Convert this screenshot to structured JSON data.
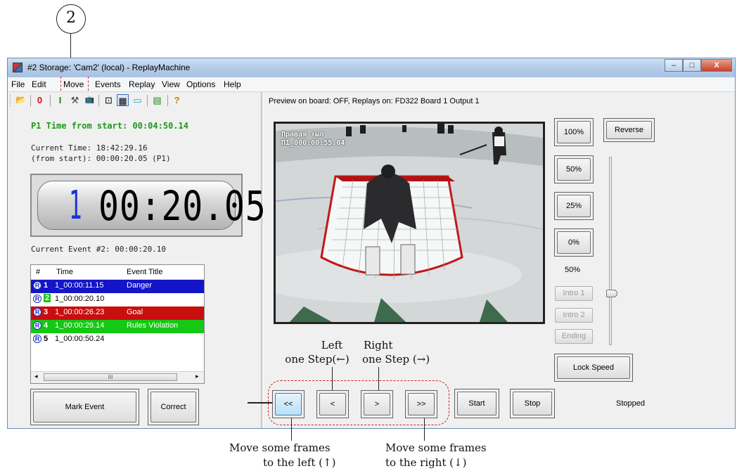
{
  "callout": {
    "number": "2"
  },
  "window": {
    "title": "#2 Storage: 'Cam2' (local) - ReplayMachine",
    "buttons": {
      "minimize": "–",
      "maximize": "□",
      "close": "X"
    }
  },
  "menu": [
    "File",
    "Edit",
    "Move",
    "Events",
    "Replay",
    "View",
    "Options",
    "Help"
  ],
  "toolbar": {
    "icons": [
      "open-folder",
      "zero",
      "info",
      "tools",
      "tv",
      "camera",
      "clapper",
      "monitor",
      "list",
      "help"
    ],
    "glyphs": [
      "📂",
      "0",
      "I",
      "⚒",
      "📺",
      "⊡",
      "▦",
      "▭",
      "▤",
      "?"
    ]
  },
  "preview_bar": "Preview on board: OFF, Replays on: FD322 Board 1 Output 1",
  "left": {
    "p1_time": "P1 Time from start: 00:04:50.14",
    "current_time": "Current Time: 18:42:29.16",
    "from_start": "(from start): 00:00:20.05 (P1)",
    "timer_index": "1",
    "timer_value": "00:20.05",
    "current_event": "Current Event #2: 00:00:20.10"
  },
  "events": {
    "headers": [
      "#",
      "Time",
      "Event Title"
    ],
    "rows": [
      {
        "num": "1",
        "time": "1_00:00:11.15",
        "title": "Danger",
        "bg": "#1414c8",
        "fg": "#ffffff"
      },
      {
        "num": "2",
        "time": "1_00:00:20.10",
        "title": "",
        "bg": "#ffffff",
        "fg": "#000000"
      },
      {
        "num": "3",
        "time": "1_00:00:26.23",
        "title": "Goal",
        "bg": "#c80e0e",
        "fg": "#ffffff"
      },
      {
        "num": "4",
        "time": "1_00:00:29.14",
        "title": "Rules Violation",
        "bg": "#14c814",
        "fg": "#ffffff"
      },
      {
        "num": "5",
        "time": "1_00:00:50.24",
        "title": "",
        "bg": "#ffffff",
        "fg": "#000000"
      }
    ],
    "scroll_glyph": "III"
  },
  "buttons": {
    "mark_event": "Mark Event",
    "correct": "Correct",
    "speed_100": "100%",
    "reverse": "Reverse",
    "speed_50": "50%",
    "speed_25": "25%",
    "speed_0": "0%",
    "speed_label": "50%",
    "intro1": "Intro 1",
    "intro2": "Intro 2",
    "ending": "Ending",
    "lock_speed": "Lock Speed",
    "step_far_left": "<<",
    "step_left": "<",
    "step_right": ">",
    "step_far_right": ">>",
    "start": "Start",
    "stop": "Stop"
  },
  "status": "Stopped",
  "video": {
    "label_line1": "Правая тыл",
    "label_line2": "П1_000:00:55.04"
  },
  "annotations": {
    "left_step_1": "Left",
    "left_step_2": "one Step(←)",
    "right_step_1": "Right",
    "right_step_2": "one Step (→)",
    "move_left_1": "Move some frames",
    "move_left_2": "to the left (↑)",
    "move_right_1": "Move some frames",
    "move_right_2": "to the right (↓)"
  },
  "colors": {
    "green_title": "#1a9a1a",
    "timer_index": "#1a35d6",
    "highlight_red": "#d12020"
  }
}
